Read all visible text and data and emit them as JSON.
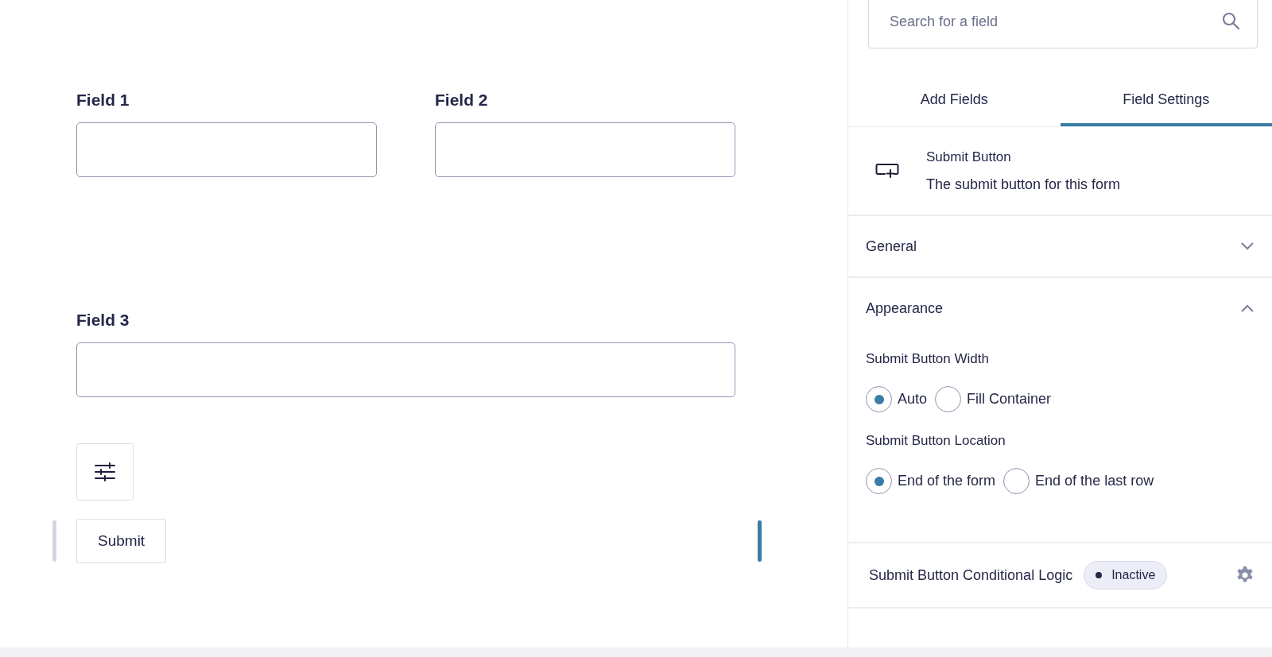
{
  "canvas": {
    "fields": [
      {
        "label": "Field 1",
        "kind": "half"
      },
      {
        "label": "Field 2",
        "kind": "half"
      },
      {
        "label": "Field 3",
        "kind": "full"
      }
    ],
    "submit_button": {
      "label": "Submit"
    }
  },
  "sidebar": {
    "search": {
      "placeholder": "Search for a field"
    },
    "tabs": [
      {
        "label": "Add Fields",
        "selected": false
      },
      {
        "label": "Field Settings",
        "selected": true
      }
    ],
    "field_header": {
      "title": "Submit Button",
      "description": "The submit button for this form"
    },
    "sections": [
      {
        "title": "General",
        "expanded": false
      },
      {
        "title": "Appearance",
        "expanded": true,
        "settings": [
          {
            "label": "Submit Button Width",
            "options": [
              {
                "label": "Auto",
                "selected": true
              },
              {
                "label": "Fill Container",
                "selected": false
              }
            ]
          },
          {
            "label": "Submit Button Location",
            "options": [
              {
                "label": "End of the form",
                "selected": true
              },
              {
                "label": "End of the last row",
                "selected": false
              }
            ]
          }
        ]
      }
    ],
    "conditional_logic": {
      "label": "Submit Button Conditional Logic",
      "status": "Inactive",
      "active": false
    }
  }
}
